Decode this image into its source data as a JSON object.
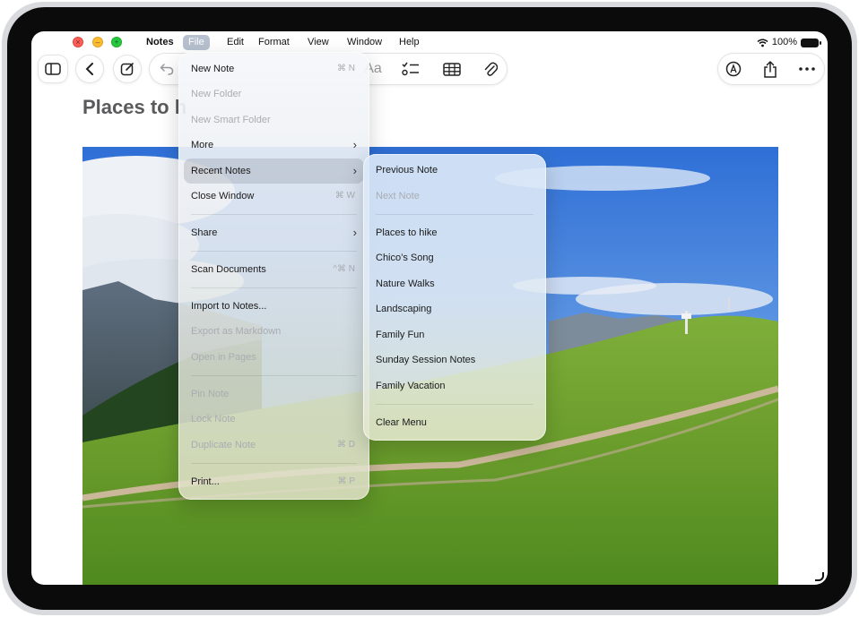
{
  "menubar": {
    "app": "Notes",
    "items": [
      "File",
      "Edit",
      "Format",
      "View",
      "Window",
      "Help"
    ],
    "battery": "100%"
  },
  "toolbar": {
    "format_label": "Aa"
  },
  "note": {
    "title": "Places to h"
  },
  "file_menu": {
    "items": [
      {
        "label": "New Note",
        "shortcut": "⌘ N"
      },
      {
        "label": "New Folder",
        "shortcut": ""
      },
      {
        "label": "New Smart Folder",
        "shortcut": ""
      },
      {
        "label": "More",
        "shortcut": ""
      },
      {
        "label": "Recent Notes",
        "shortcut": ""
      },
      {
        "label": "Close Window",
        "shortcut": "⌘ W"
      },
      {
        "label": "Share",
        "shortcut": ""
      },
      {
        "label": "Scan Documents",
        "shortcut": "^⌘ N"
      },
      {
        "label": "Import to Notes...",
        "shortcut": ""
      },
      {
        "label": "Export as Markdown",
        "shortcut": ""
      },
      {
        "label": "Open in Pages",
        "shortcut": ""
      },
      {
        "label": "Pin Note",
        "shortcut": ""
      },
      {
        "label": "Lock Note",
        "shortcut": ""
      },
      {
        "label": "Duplicate Note",
        "shortcut": "⌘ D"
      },
      {
        "label": "Print...",
        "shortcut": "⌘ P"
      }
    ]
  },
  "recent_menu": {
    "items": [
      {
        "label": "Previous Note"
      },
      {
        "label": "Next Note"
      },
      {
        "label": "Places to hike"
      },
      {
        "label": "Chico’s Song"
      },
      {
        "label": "Nature Walks"
      },
      {
        "label": "Landscaping"
      },
      {
        "label": "Family Fun"
      },
      {
        "label": "Sunday Session Notes"
      },
      {
        "label": "Family Vacation"
      },
      {
        "label": "Clear Menu"
      }
    ]
  }
}
